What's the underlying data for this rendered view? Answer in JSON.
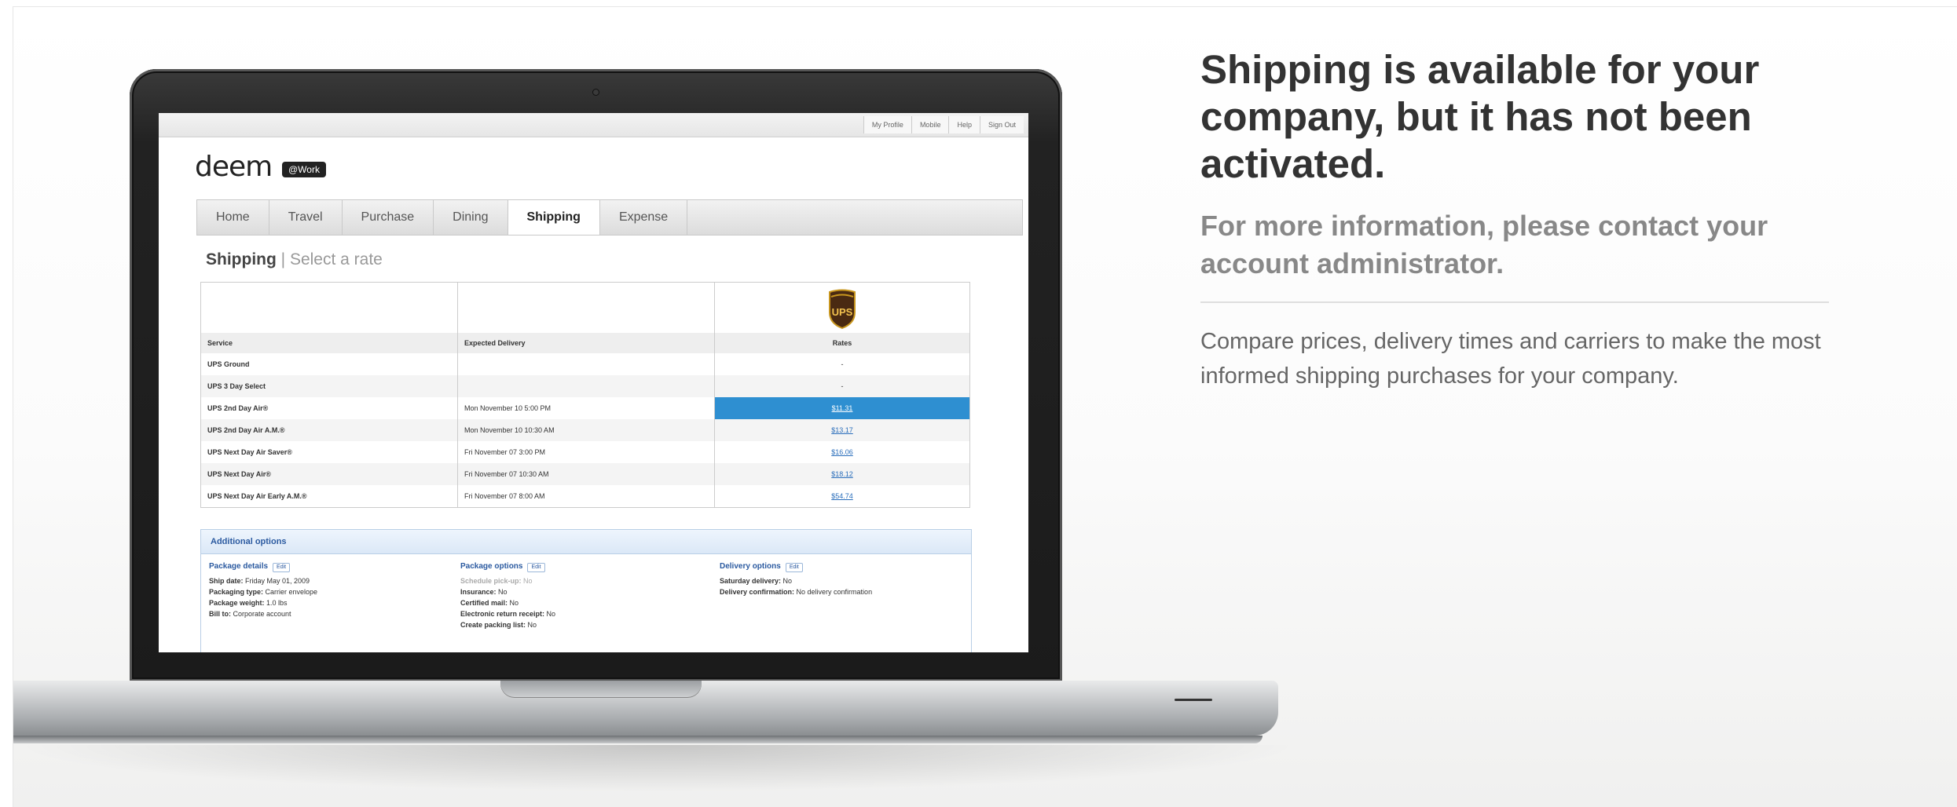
{
  "top_links": [
    "My Profile",
    "Mobile",
    "Help",
    "Sign Out"
  ],
  "logo": {
    "text": "deem",
    "badge": "@Work"
  },
  "nav_tabs": [
    {
      "label": "Home",
      "active": false
    },
    {
      "label": "Travel",
      "active": false
    },
    {
      "label": "Purchase",
      "active": false
    },
    {
      "label": "Dining",
      "active": false
    },
    {
      "label": "Shipping",
      "active": true
    },
    {
      "label": "Expense",
      "active": false
    }
  ],
  "page_title": {
    "main": "Shipping",
    "separator": " | ",
    "sub": "Select a rate"
  },
  "rates_table": {
    "carrier_logo": "UPS",
    "headers": [
      "Service",
      "Expected Delivery",
      "Rates"
    ],
    "rows": [
      {
        "service": "UPS Ground",
        "delivery": "",
        "rate": "-"
      },
      {
        "service": "UPS 3 Day Select",
        "delivery": "",
        "rate": "-"
      },
      {
        "service": "UPS 2nd Day Air®",
        "delivery": "Mon November 10 5:00 PM",
        "rate": "$11.31",
        "selected": true
      },
      {
        "service": "UPS 2nd Day Air A.M.®",
        "delivery": "Mon November 10 10:30 AM",
        "rate": "$13.17"
      },
      {
        "service": "UPS Next Day Air Saver®",
        "delivery": "Fri November 07 3:00 PM",
        "rate": "$16.06"
      },
      {
        "service": "UPS Next Day Air®",
        "delivery": "Fri November 07 10:30 AM",
        "rate": "$18.12"
      },
      {
        "service": "UPS Next Day Air Early A.M.®",
        "delivery": "Fri November 07 8:00 AM",
        "rate": "$54.74"
      }
    ]
  },
  "additional_options": {
    "title": "Additional options",
    "edit_label": "Edit",
    "package_details": {
      "title": "Package details",
      "lines": [
        {
          "k": "Ship date:",
          "v": " Friday May 01, 2009"
        },
        {
          "k": "Packaging type:",
          "v": " Carrier envelope"
        },
        {
          "k": "Package weight:",
          "v": " 1.0 lbs"
        },
        {
          "k": "Bill to:",
          "v": " Corporate account"
        }
      ]
    },
    "package_options": {
      "title": "Package options",
      "lines": [
        {
          "k": "Schedule pick-up:",
          "v": " No",
          "muted": true
        },
        {
          "k": "Insurance:",
          "v": " No"
        },
        {
          "k": "Certified mail:",
          "v": " No"
        },
        {
          "k": "Electronic return receipt:",
          "v": " No"
        },
        {
          "k": "Create packing list:",
          "v": " No"
        }
      ]
    },
    "delivery_options": {
      "title": "Delivery options",
      "lines": [
        {
          "k": "Saturday delivery:",
          "v": " No"
        },
        {
          "k": "Delivery confirmation:",
          "v": " No delivery confirmation"
        }
      ]
    }
  },
  "promo": {
    "headline": "Shipping is available for your company, but it has not been activated.",
    "subhead": "For more information, please contact your account administrator.",
    "body": "Compare prices, delivery times and carriers to make the most informed shipping purchases for your company."
  }
}
